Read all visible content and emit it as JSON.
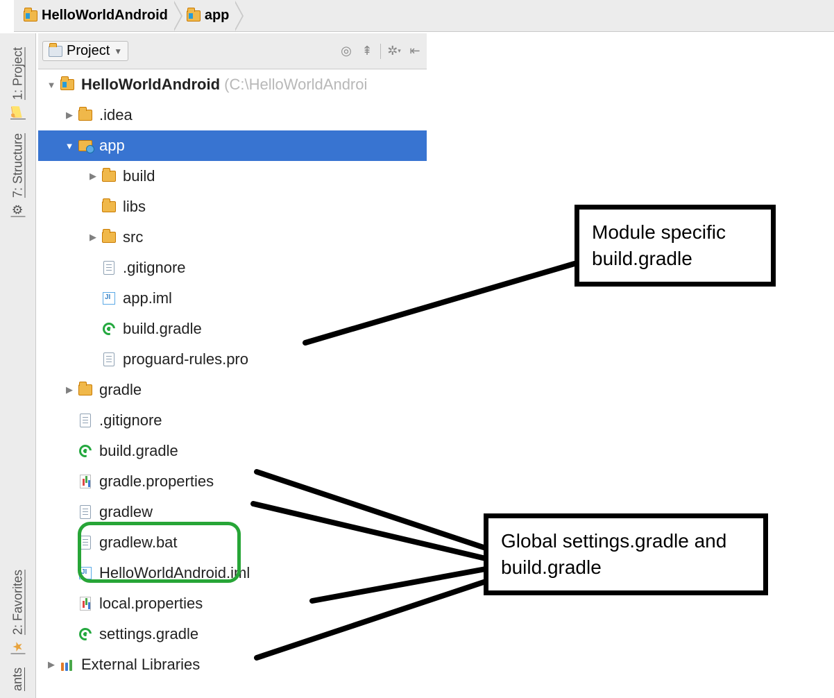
{
  "breadcrumb": {
    "items": [
      {
        "label": "HelloWorldAndroid",
        "bold": true
      },
      {
        "label": "app",
        "bold": true
      }
    ]
  },
  "sideTabs": {
    "project": "1: Project",
    "structure": "7: Structure",
    "favorites": "2: Favorites",
    "ants": "ants"
  },
  "projectHeader": {
    "viewLabel": "Project"
  },
  "tree": {
    "root": {
      "label": "HelloWorldAndroid",
      "path": "(C:\\HelloWorldAndroi"
    },
    "idea": ".idea",
    "app": "app",
    "app_children": {
      "build": "build",
      "libs": "libs",
      "src": "src",
      "gitignore": ".gitignore",
      "app_iml": "app.iml",
      "build_gradle": "build.gradle",
      "proguard": "proguard-rules.pro"
    },
    "gradle": "gradle",
    "gitignore_root": ".gitignore",
    "build_gradle_root": "build.gradle",
    "gradle_properties": "gradle.properties",
    "gradlew": "gradlew",
    "gradlew_bat": "gradlew.bat",
    "project_iml": "HelloWorldAndroid.iml",
    "local_properties": "local.properties",
    "settings_gradle": "settings.gradle",
    "external_libs": "External Libraries"
  },
  "annotations": {
    "module_box": "Module specific build.gradle",
    "global_box": "Global settings.gradle and build.gradle"
  }
}
